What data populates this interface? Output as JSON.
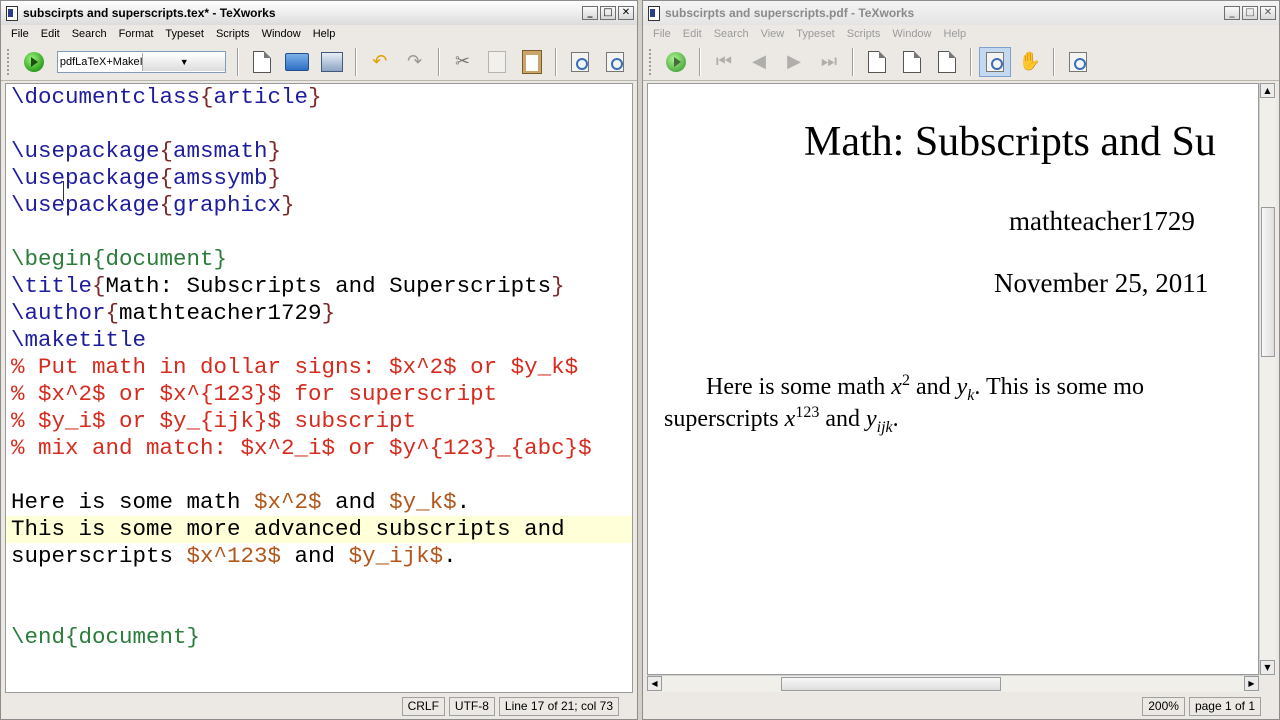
{
  "editor_window": {
    "title": "subscirpts and superscripts.tex* - TeXworks",
    "menu": [
      "File",
      "Edit",
      "Search",
      "Format",
      "Typeset",
      "Scripts",
      "Window",
      "Help"
    ],
    "engine": "pdfLaTeX+MakeIndex+BibTeX",
    "status": {
      "line_ending": "CRLF",
      "encoding": "UTF-8",
      "position": "Line 17 of 21; col 73"
    }
  },
  "source_lines": [
    [
      {
        "c": "cmd",
        "t": "\\documentclass"
      },
      {
        "c": "brace",
        "t": "{"
      },
      {
        "c": "arg",
        "t": "article"
      },
      {
        "c": "brace",
        "t": "}"
      }
    ],
    [],
    [
      {
        "c": "cmd",
        "t": "\\usepackage"
      },
      {
        "c": "brace",
        "t": "{"
      },
      {
        "c": "arg",
        "t": "amsmath"
      },
      {
        "c": "brace",
        "t": "}"
      }
    ],
    [
      {
        "c": "cmd",
        "t": "\\usepackage"
      },
      {
        "c": "brace",
        "t": "{"
      },
      {
        "c": "arg",
        "t": "amssymb"
      },
      {
        "c": "brace",
        "t": "}"
      }
    ],
    [
      {
        "c": "cmd",
        "t": "\\usepackage"
      },
      {
        "c": "brace",
        "t": "{"
      },
      {
        "c": "arg",
        "t": "graphicx"
      },
      {
        "c": "brace",
        "t": "}"
      }
    ],
    [],
    [
      {
        "c": "env",
        "t": "\\begin{document}"
      }
    ],
    [
      {
        "c": "cmd",
        "t": "\\title"
      },
      {
        "c": "brace",
        "t": "{"
      },
      {
        "c": "txt",
        "t": "Math: Subscripts and Superscripts"
      },
      {
        "c": "brace",
        "t": "}"
      }
    ],
    [
      {
        "c": "cmd",
        "t": "\\author"
      },
      {
        "c": "brace",
        "t": "{"
      },
      {
        "c": "txt",
        "t": "mathteacher1729"
      },
      {
        "c": "brace",
        "t": "}"
      }
    ],
    [
      {
        "c": "cmd",
        "t": "\\maketitle"
      }
    ],
    [
      {
        "c": "comment",
        "t": "% Put math in dollar signs: $x^2$ or $y_k$"
      }
    ],
    [
      {
        "c": "comment",
        "t": "% $x^2$ or $x^{123}$ for superscript"
      }
    ],
    [
      {
        "c": "comment",
        "t": "% $y_i$ or $y_{ijk}$ subscript"
      }
    ],
    [
      {
        "c": "comment",
        "t": "% mix and match: $x^2_i$ or $y^{123}_{abc}$"
      }
    ],
    [],
    [
      {
        "c": "txt",
        "t": "Here is some math "
      },
      {
        "c": "math",
        "t": "$x^2$"
      },
      {
        "c": "txt",
        "t": " and "
      },
      {
        "c": "math",
        "t": "$y_k$"
      },
      {
        "c": "txt",
        "t": "."
      }
    ],
    [
      {
        "c": "txt",
        "t": "This is some more advanced subscripts and"
      }
    ],
    [
      {
        "c": "txt",
        "t": "superscripts "
      },
      {
        "c": "math",
        "t": "$x^123$"
      },
      {
        "c": "txt",
        "t": " and "
      },
      {
        "c": "math",
        "t": "$y_ijk$"
      },
      {
        "c": "txt",
        "t": "."
      }
    ],
    [],
    [],
    [
      {
        "c": "env",
        "t": "\\end{document}"
      }
    ]
  ],
  "highlight_line": 17,
  "pdf_window": {
    "title": "subscirpts and superscripts.pdf - TeXworks",
    "menu": [
      "File",
      "Edit",
      "Search",
      "View",
      "Typeset",
      "Scripts",
      "Window",
      "Help"
    ],
    "zoom": "200%",
    "page": "page 1 of 1"
  },
  "pdf_content": {
    "title": "Math: Subscripts and Su",
    "author": "mathteacher1729",
    "date": "November 25, 2011",
    "para1": {
      "a": "Here is some math ",
      "x": "x",
      "x_sup": "2",
      "b": " and ",
      "y": "y",
      "y_sub": "k",
      "c": ". This is some mo"
    },
    "para2": {
      "a": "superscripts ",
      "x": "x",
      "x_sup": "123",
      "b": " and ",
      "y": "y",
      "y_sub": "ijk",
      "c": "."
    }
  }
}
